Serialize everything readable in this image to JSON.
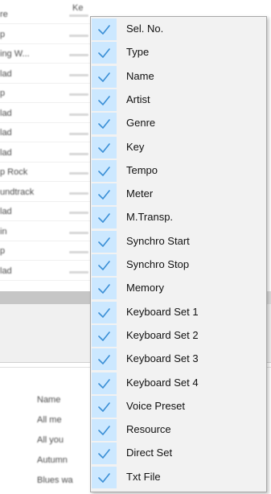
{
  "background": {
    "top_cells": [
      "re",
      "Ke"
    ],
    "table_rows": [
      {
        "a": "re"
      },
      {
        "a": "p"
      },
      {
        "a": "ing W..."
      },
      {
        "a": "lad"
      },
      {
        "a": "p"
      },
      {
        "a": "lad"
      },
      {
        "a": "lad"
      },
      {
        "a": "lad"
      },
      {
        "a": "p Rock"
      },
      {
        "a": "undtrack"
      },
      {
        "a": "lad"
      },
      {
        "a": "in"
      },
      {
        "a": "p"
      },
      {
        "a": "lad"
      }
    ],
    "list_items": [
      "Name",
      "All me",
      "All you",
      "Autumn",
      "Blues wa"
    ]
  },
  "context_menu": {
    "check_color": "#3a8fd6",
    "check_bg": "#cce8ff",
    "items": [
      {
        "label": "Sel. No.",
        "checked": true
      },
      {
        "label": "Type",
        "checked": true
      },
      {
        "label": "Name",
        "checked": true
      },
      {
        "label": "Artist",
        "checked": true
      },
      {
        "label": "Genre",
        "checked": true
      },
      {
        "label": "Key",
        "checked": true
      },
      {
        "label": "Tempo",
        "checked": true
      },
      {
        "label": "Meter",
        "checked": true
      },
      {
        "label": "M.Transp.",
        "checked": true
      },
      {
        "label": "Synchro Start",
        "checked": true
      },
      {
        "label": "Synchro Stop",
        "checked": true
      },
      {
        "label": "Memory",
        "checked": true
      },
      {
        "label": "Keyboard Set 1",
        "checked": true
      },
      {
        "label": "Keyboard Set 2",
        "checked": true
      },
      {
        "label": "Keyboard Set 3",
        "checked": true
      },
      {
        "label": "Keyboard Set 4",
        "checked": true
      },
      {
        "label": "Voice Preset",
        "checked": true
      },
      {
        "label": "Resource",
        "checked": true
      },
      {
        "label": "Direct Set",
        "checked": true
      },
      {
        "label": "Txt File",
        "checked": true
      }
    ]
  }
}
